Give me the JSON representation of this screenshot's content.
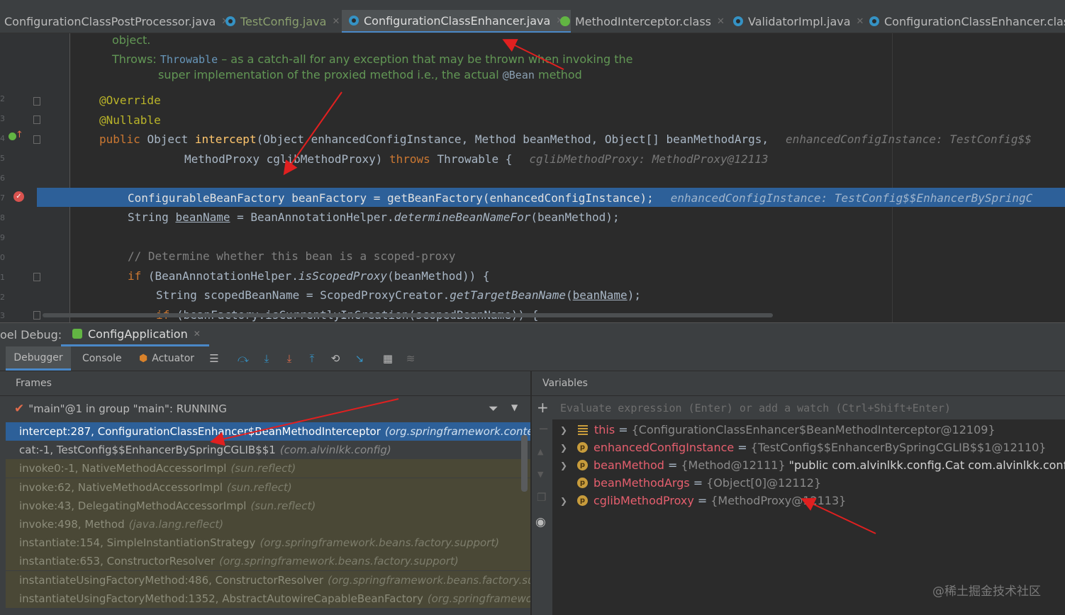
{
  "tabs": [
    {
      "label": "ConfigurationClassPostProcessor.java",
      "icon": "class-icon",
      "active": false
    },
    {
      "label": "TestConfig.java",
      "icon": "class-icon",
      "active": false
    },
    {
      "label": "ConfigurationClassEnhancer.java",
      "icon": "class-icon",
      "active": true
    },
    {
      "label": "MethodInterceptor.class",
      "icon": "interface-icon",
      "active": false
    },
    {
      "label": "ValidatorImpl.java",
      "icon": "class-icon",
      "active": false
    },
    {
      "label": "ConfigurationClassEnhancer.class",
      "icon": "class-icon",
      "active": false
    }
  ],
  "editor": {
    "doc_line1": "object.",
    "doc_throws_label": "Throws:",
    "doc_throws_type": "Throwable",
    "doc_throws_text": "– as a catch-all for any exception that may be thrown when invoking the",
    "doc_line3a": "super implementation of the proxied method i.e., the actual",
    "doc_line3b": "@Bean",
    "doc_line3c": "method",
    "line_numbers": [
      "2",
      "3",
      "4",
      "5",
      "6",
      "7",
      "8",
      "9",
      "0",
      "1",
      "2",
      "3"
    ],
    "ann_override": "@Override",
    "ann_nullable": "@Nullable",
    "sig1": {
      "kw": "public",
      "type": "Object",
      "name": "intercept",
      "params": "(Object enhancedConfigInstance, Method beanMethod, Object[] beanMethodArgs,",
      "hint": "enhancedConfigInstance: TestConfig$$"
    },
    "sig2": {
      "params": "MethodProxy cglibMethodProxy)",
      "kw": "throws",
      "rest": "Throwable {",
      "hint": "cglibMethodProxy: MethodProxy@12113"
    },
    "exec": {
      "code": "ConfigurableBeanFactory beanFactory = getBeanFactory(enhancedConfigInstance);",
      "hint": "enhancedConfigInstance: TestConfig$$EnhancerBySpringC"
    },
    "l2": {
      "a": "String ",
      "b": "beanName",
      "c": " = BeanAnnotationHelper.",
      "d": "determineBeanNameFor",
      "e": "(beanMethod);"
    },
    "comment": "// Determine whether this bean is a scoped-proxy",
    "l4": {
      "kw": "if",
      "a": " (BeanAnnotationHelper.",
      "b": "isScopedProxy",
      "c": "(beanMethod)) {"
    },
    "l5": {
      "a": "String scopedBeanName = ScopedProxyCreator.",
      "b": "getTargetBeanName",
      "c": "(",
      "d": "beanName",
      "e": ");"
    },
    "l6": {
      "kw": "if",
      "a": " (beanFactory.isCurrentlyInCreation(scopedBeanName)) {"
    }
  },
  "debug": {
    "label": "oel Debug:",
    "session": "ConfigApplication",
    "tabs": [
      "Debugger",
      "Console",
      "Actuator"
    ]
  },
  "frames": {
    "title": "Frames",
    "thread": "\"main\"@1 in group \"main\": RUNNING",
    "items": [
      {
        "text": "intercept:287, ConfigurationClassEnhancer$BeanMethodInterceptor",
        "pkg": "(org.springframework.context",
        "kind": "sel"
      },
      {
        "text": "cat:-1, TestConfig$$EnhancerBySpringCGLIB$$1",
        "pkg": "(com.alvinlkk.config)",
        "kind": "user"
      },
      {
        "text": "invoke0:-1, NativeMethodAccessorImpl",
        "pkg": "(sun.reflect)",
        "kind": "lib"
      },
      {
        "text": "invoke:62, NativeMethodAccessorImpl",
        "pkg": "(sun.reflect)",
        "kind": "lib"
      },
      {
        "text": "invoke:43, DelegatingMethodAccessorImpl",
        "pkg": "(sun.reflect)",
        "kind": "lib"
      },
      {
        "text": "invoke:498, Method",
        "pkg": "(java.lang.reflect)",
        "kind": "lib"
      },
      {
        "text": "instantiate:154, SimpleInstantiationStrategy",
        "pkg": "(org.springframework.beans.factory.support)",
        "kind": "lib"
      },
      {
        "text": "instantiate:653, ConstructorResolver",
        "pkg": "(org.springframework.beans.factory.support)",
        "kind": "lib"
      },
      {
        "text": "instantiateUsingFactoryMethod:486, ConstructorResolver",
        "pkg": "(org.springframework.beans.factory.supp",
        "kind": "lib"
      },
      {
        "text": "instantiateUsingFactoryMethod:1352, AbstractAutowireCapableBeanFactory",
        "pkg": "(org.springframework",
        "kind": "lib"
      }
    ]
  },
  "variables": {
    "title": "Variables",
    "eval_placeholder": "Evaluate expression (Enter) or add a watch (Ctrl+Shift+Enter)",
    "items": [
      {
        "name": "this",
        "value": "{ConfigurationClassEnhancer$BeanMethodInterceptor@12109}",
        "extra": "",
        "icon": "lines"
      },
      {
        "name": "enhancedConfigInstance",
        "value": "{TestConfig$$EnhancerBySpringCGLIB$$1@12110}",
        "extra": "",
        "icon": "p"
      },
      {
        "name": "beanMethod",
        "value": "{Method@12111}",
        "extra": "\"public com.alvinlkk.config.Cat com.alvinlkk.config.TestCo",
        "icon": "p"
      },
      {
        "name": "beanMethodArgs",
        "value": "{Object[0]@12112}",
        "extra": "",
        "icon": "p"
      },
      {
        "name": "cglibMethodProxy",
        "value": "{MethodProxy@12113}",
        "extra": "",
        "icon": "p"
      }
    ]
  },
  "watermark": "@稀土掘金技术社区",
  "colors": {
    "accent": "#4a88c7",
    "selection": "#2d6099",
    "annotation_arrow": "#e02020"
  }
}
